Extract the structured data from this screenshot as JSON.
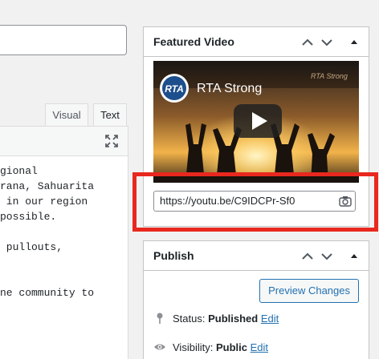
{
  "editor": {
    "tabs": {
      "visual": "Visual",
      "text": "Text"
    },
    "lines": [
      "gional",
      "rana, Sahuarita",
      " in our region",
      "possible.",
      "",
      " pullouts,",
      "",
      "",
      "ne community to"
    ]
  },
  "featured_video": {
    "title": "Featured Video",
    "video_title": "RTA Strong",
    "channel_logo": "RTA",
    "watermark": "RTA Strong",
    "url": "https://youtu.be/C9IDCPr-Sf0"
  },
  "publish": {
    "title": "Publish",
    "preview_label": "Preview Changes",
    "status_label": "Status:",
    "status_value": "Published",
    "status_edit": "Edit",
    "visibility_label": "Visibility:",
    "visibility_value": "Public",
    "visibility_edit": "Edit"
  },
  "colors": {
    "highlight": "#e8281e",
    "link": "#2271b1"
  }
}
